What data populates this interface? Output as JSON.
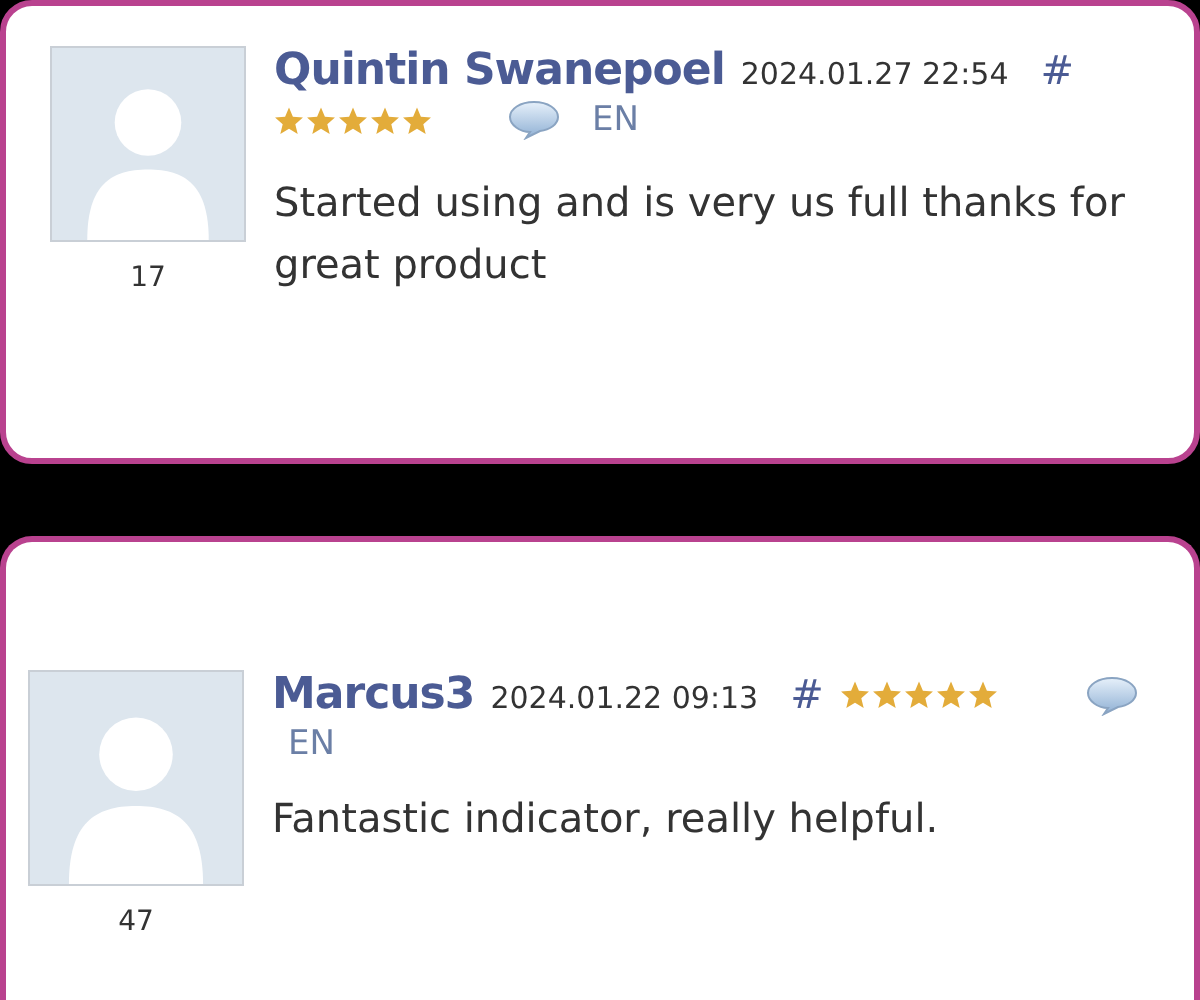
{
  "reviews": [
    {
      "author": "Quintin Swanepoel",
      "date": "2024.01.27 22:54",
      "link": "#",
      "stars": 5,
      "language": "EN",
      "count": "17",
      "text": "Started using and is very us full thanks for great product"
    },
    {
      "author": "Marcus3",
      "date": "2024.01.22 09:13",
      "link": "#",
      "stars": 5,
      "language": "EN",
      "count": "47",
      "text": "Fantastic indicator, really helpful."
    }
  ]
}
